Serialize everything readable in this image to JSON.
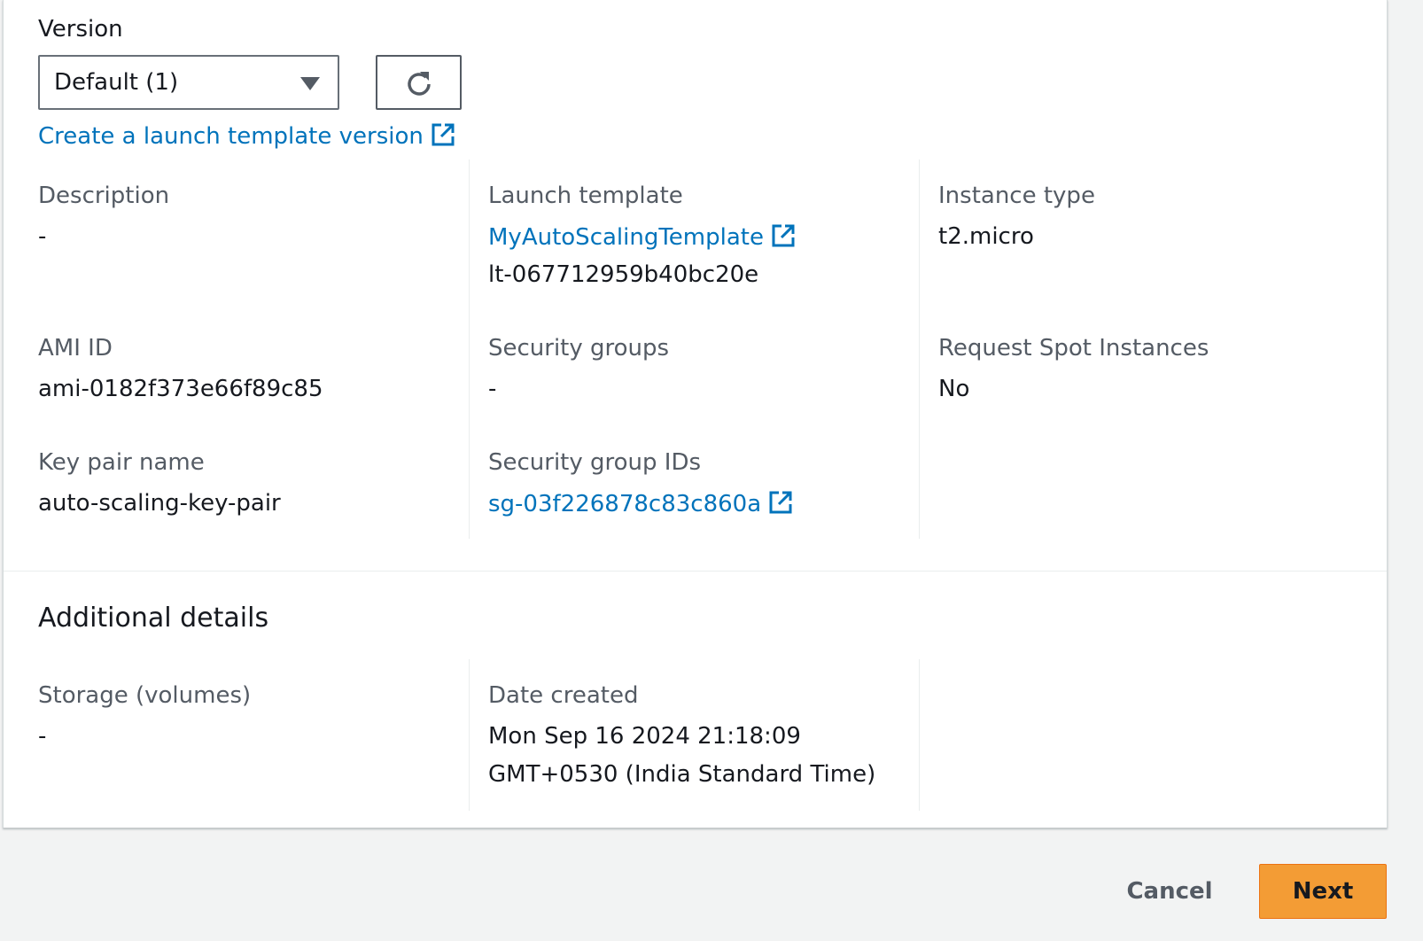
{
  "version_section": {
    "label": "Version",
    "select_value": "Default (1)",
    "create_link": "Create a launch template version"
  },
  "details": {
    "description": {
      "label": "Description",
      "value": "-"
    },
    "launch_template": {
      "label": "Launch template",
      "name": "MyAutoScalingTemplate",
      "id": "lt-067712959b40bc20e"
    },
    "instance_type": {
      "label": "Instance type",
      "value": "t2.micro"
    },
    "ami_id": {
      "label": "AMI ID",
      "value": "ami-0182f373e66f89c85"
    },
    "security_groups": {
      "label": "Security groups",
      "value": "-"
    },
    "request_spot": {
      "label": "Request Spot Instances",
      "value": "No"
    },
    "key_pair": {
      "label": "Key pair name",
      "value": "auto-scaling-key-pair"
    },
    "security_group_ids": {
      "label": "Security group IDs",
      "value": "sg-03f226878c83c860a"
    }
  },
  "additional": {
    "heading": "Additional details",
    "storage": {
      "label": "Storage (volumes)",
      "value": "-"
    },
    "date_created": {
      "label": "Date created",
      "line1": "Mon Sep 16 2024 21:18:09",
      "line2": "GMT+0530 (India Standard Time)"
    }
  },
  "footer": {
    "cancel_label": "Cancel",
    "next_label": "Next"
  },
  "colors": {
    "link": "#0073bb",
    "primary_button": "#f39c35",
    "label_text": "#545b64",
    "value_text": "#16191f"
  }
}
